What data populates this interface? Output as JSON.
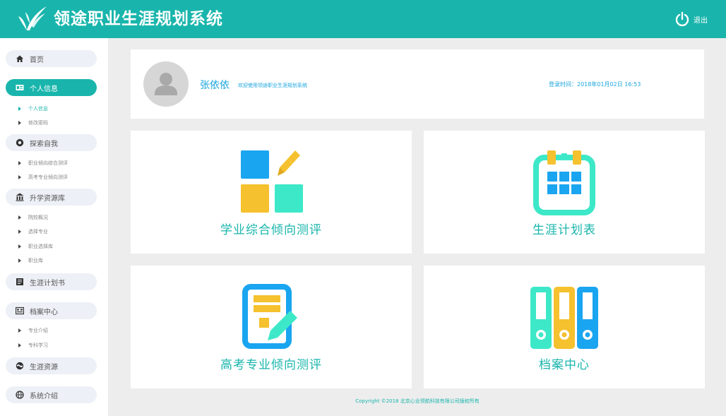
{
  "header": {
    "title": "领途职业生涯规划系统",
    "logout_label": "退出"
  },
  "sidebar": {
    "groups": [
      {
        "label": "首页",
        "icon": "home-icon"
      },
      {
        "label": "个人信息",
        "icon": "id-card-icon",
        "active": true,
        "sub": [
          "个人信息",
          "修改密码"
        ]
      },
      {
        "label": "探索自我",
        "icon": "compass-icon",
        "sub": [
          "职业倾向综合测评",
          "高考专业倾向测评"
        ]
      },
      {
        "label": "升学资源库",
        "icon": "building-icon",
        "sub": [
          "院校概况",
          "选择专业",
          "职业选择库",
          "职业库"
        ]
      },
      {
        "label": "生涯计划书",
        "icon": "book-icon"
      },
      {
        "label": "档案中心",
        "icon": "archive-icon",
        "sub": [
          "专业介绍",
          "专科学习"
        ]
      },
      {
        "label": "生涯资源",
        "icon": "globe-icon"
      },
      {
        "label": "系统介绍",
        "icon": "info-globe-icon"
      }
    ]
  },
  "profile": {
    "name": "张依依",
    "welcome": "欢迎使用领途职业生涯规划系统",
    "login_time": "登录时间：2018年01月02日 16:53"
  },
  "cards": [
    {
      "title": "学业综合倾向测评",
      "icon": "assessment-blocks-icon"
    },
    {
      "title": "生涯计划表",
      "icon": "calendar-icon"
    },
    {
      "title": "高考专业倾向测评",
      "icon": "exam-pencil-icon"
    },
    {
      "title": "档案中心",
      "icon": "binders-icon"
    }
  ],
  "footer": {
    "copyright": "Copyright ©2018 北京心业领航科技有限公司版权所有"
  },
  "colors": {
    "brand_teal": "#19b5ac",
    "link_blue": "#1aa5dc",
    "icon_yellow": "#f5c12e",
    "icon_mint": "#3de8c8",
    "icon_blue": "#1aa5f0"
  }
}
